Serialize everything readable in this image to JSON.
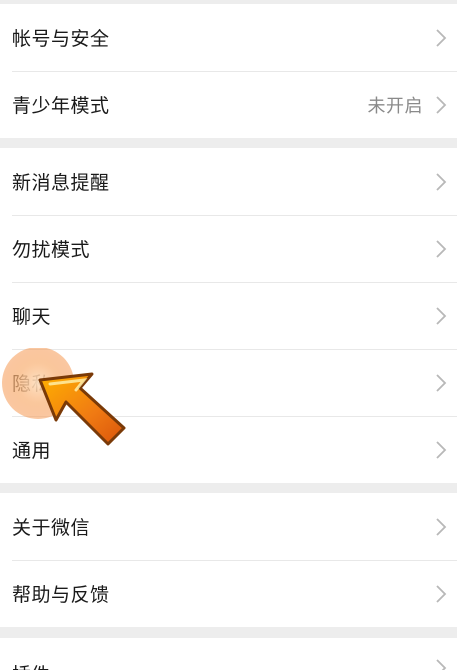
{
  "group1": {
    "items": [
      {
        "label": "帐号与安全",
        "value": ""
      },
      {
        "label": "青少年模式",
        "value": "未开启"
      }
    ]
  },
  "group2": {
    "items": [
      {
        "label": "新消息提醒"
      },
      {
        "label": "勿扰模式"
      },
      {
        "label": "聊天"
      },
      {
        "label": "隐私"
      },
      {
        "label": "通用"
      }
    ]
  },
  "group3": {
    "items": [
      {
        "label": "关于微信"
      },
      {
        "label": "帮助与反馈"
      }
    ]
  },
  "group4": {
    "items": [
      {
        "label": "插件"
      }
    ]
  },
  "icons": {
    "chevron": "chevron-right-icon",
    "pointer": "pointing-arrow-icon"
  },
  "colors": {
    "background": "#ededed",
    "surface": "#ffffff",
    "text": "#1a1a1a",
    "secondary_text": "#8a8a8a",
    "chevron": "#b8b8b8",
    "arrow_orange": "#f07a13"
  }
}
